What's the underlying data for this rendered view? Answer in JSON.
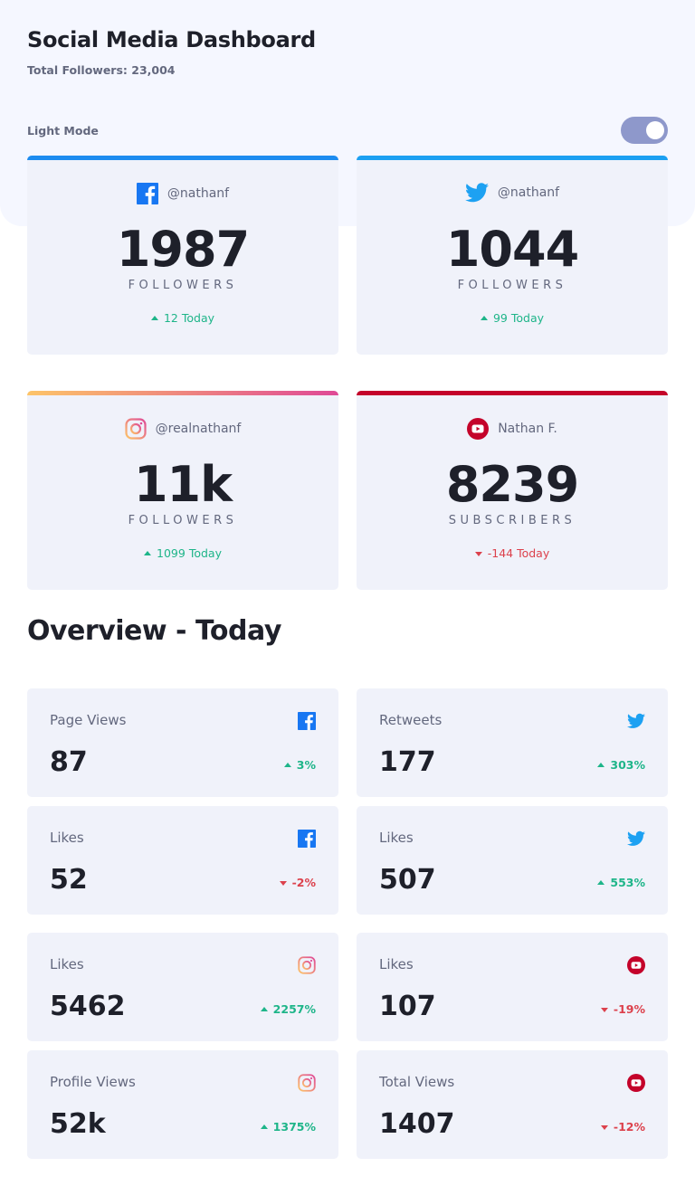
{
  "header": {
    "title": "Social Media Dashboard",
    "total_followers": "Total Followers: 23,004",
    "mode_label": "Light Mode"
  },
  "colors": {
    "facebook": "#1877f2",
    "twitter": "#1da1f2",
    "instagram_start": "#fdc468",
    "instagram_end": "#df4996",
    "youtube": "#c4032a",
    "up": "#1eb589",
    "down": "#dc414c"
  },
  "cards": [
    {
      "network": "facebook",
      "icon": "facebook-icon",
      "handle": "@nathanf",
      "count": "1987",
      "label": "FOLLOWERS",
      "today": "12 Today",
      "trend": "up"
    },
    {
      "network": "twitter",
      "icon": "twitter-icon",
      "handle": "@nathanf",
      "count": "1044",
      "label": "FOLLOWERS",
      "today": "99 Today",
      "trend": "up"
    },
    {
      "network": "instagram",
      "icon": "instagram-icon",
      "handle": "@realnathanf",
      "count": "11k",
      "label": "FOLLOWERS",
      "today": "1099 Today",
      "trend": "up"
    },
    {
      "network": "youtube",
      "icon": "youtube-icon",
      "handle": "Nathan F.",
      "count": "8239",
      "label": "SUBSCRIBERS",
      "today": "-144 Today",
      "trend": "down"
    }
  ],
  "overview": {
    "title": "Overview - Today",
    "items": [
      {
        "label": "Page Views",
        "icon": "facebook-icon",
        "value": "87",
        "change": "3%",
        "trend": "up"
      },
      {
        "label": "Retweets",
        "icon": "twitter-icon",
        "value": "177",
        "change": "303%",
        "trend": "up"
      },
      {
        "label": "Likes",
        "icon": "facebook-icon",
        "value": "52",
        "change": "-2%",
        "trend": "down"
      },
      {
        "label": "Likes",
        "icon": "twitter-icon",
        "value": "507",
        "change": "553%",
        "trend": "up"
      },
      {
        "label": "Likes",
        "icon": "instagram-icon",
        "value": "5462",
        "change": "2257%",
        "trend": "up"
      },
      {
        "label": "Likes",
        "icon": "youtube-icon",
        "value": "107",
        "change": "-19%",
        "trend": "down"
      },
      {
        "label": "Profile Views",
        "icon": "instagram-icon",
        "value": "52k",
        "change": "1375%",
        "trend": "up"
      },
      {
        "label": "Total Views",
        "icon": "youtube-icon",
        "value": "1407",
        "change": "-12%",
        "trend": "down"
      }
    ]
  }
}
